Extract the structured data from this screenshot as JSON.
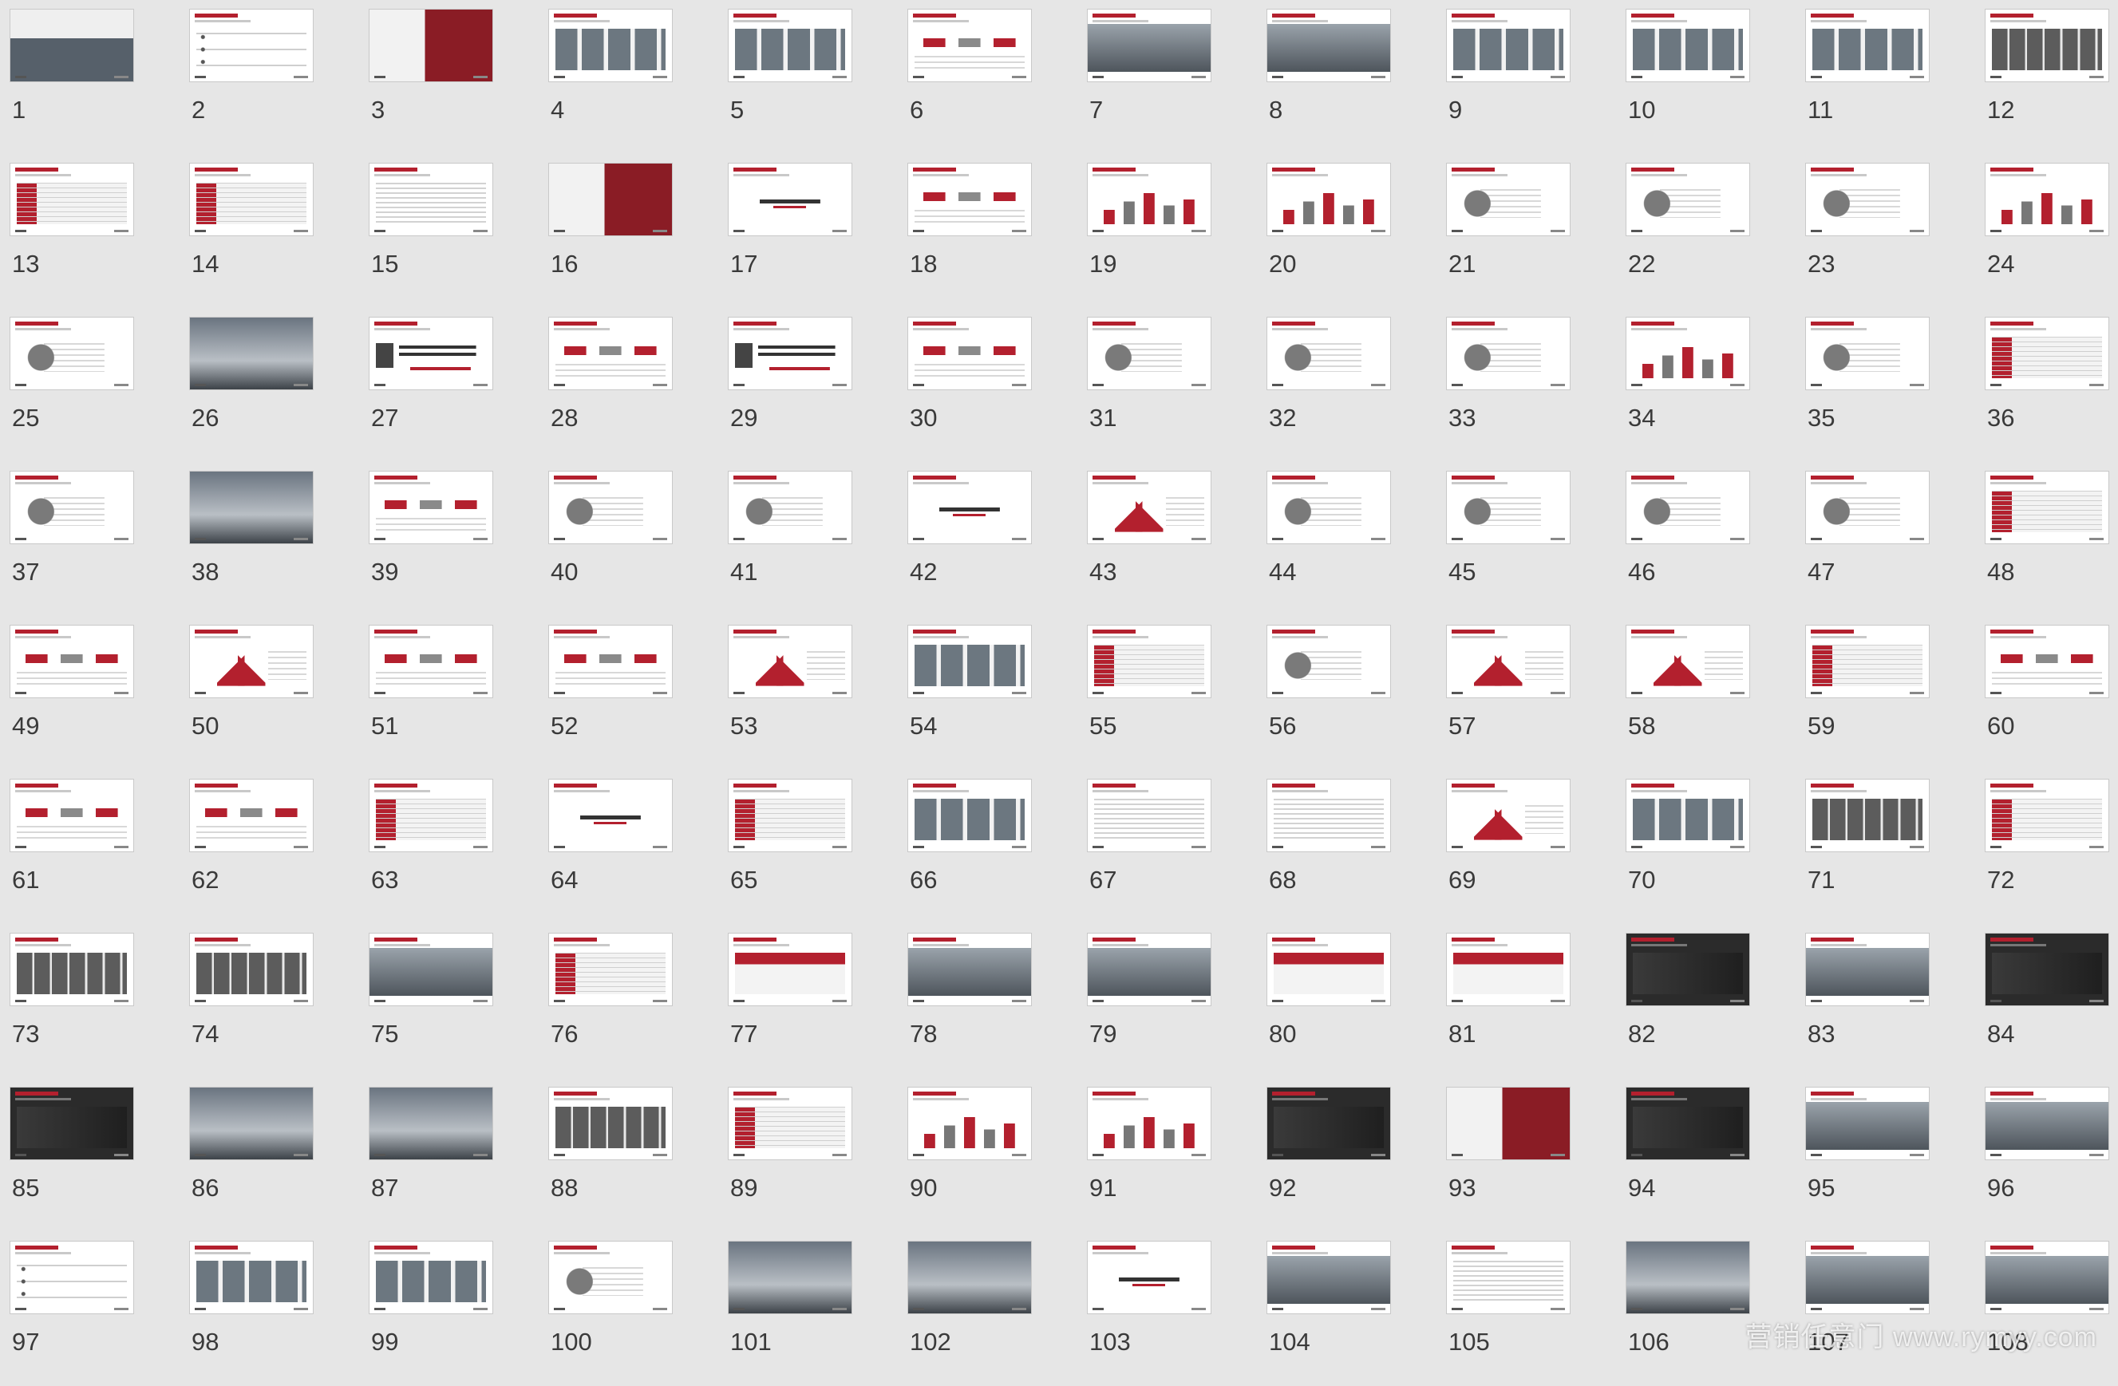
{
  "slides": [
    {
      "n": "1",
      "v": "cover"
    },
    {
      "n": "2",
      "v": "list"
    },
    {
      "n": "3",
      "v": "red"
    },
    {
      "n": "4",
      "v": "grid"
    },
    {
      "n": "5",
      "v": "grid"
    },
    {
      "n": "6",
      "v": "flow"
    },
    {
      "n": "7",
      "v": "photo"
    },
    {
      "n": "8",
      "v": "photo"
    },
    {
      "n": "9",
      "v": "grid"
    },
    {
      "n": "10",
      "v": "grid"
    },
    {
      "n": "11",
      "v": "grid"
    },
    {
      "n": "12",
      "v": "people"
    },
    {
      "n": "13",
      "v": "table"
    },
    {
      "n": "14",
      "v": "table"
    },
    {
      "n": "15",
      "v": "text"
    },
    {
      "n": "16",
      "v": "red"
    },
    {
      "n": "17",
      "v": "white"
    },
    {
      "n": "18",
      "v": "flow"
    },
    {
      "n": "19",
      "v": "chart"
    },
    {
      "n": "20",
      "v": "chart"
    },
    {
      "n": "21",
      "v": "circle"
    },
    {
      "n": "22",
      "v": "circle"
    },
    {
      "n": "23",
      "v": "circle"
    },
    {
      "n": "24",
      "v": "chart"
    },
    {
      "n": "25",
      "v": "circle"
    },
    {
      "n": "26",
      "v": "hero"
    },
    {
      "n": "27",
      "v": "year"
    },
    {
      "n": "28",
      "v": "flow"
    },
    {
      "n": "29",
      "v": "year"
    },
    {
      "n": "30",
      "v": "flow"
    },
    {
      "n": "31",
      "v": "circle"
    },
    {
      "n": "32",
      "v": "circle"
    },
    {
      "n": "33",
      "v": "circle"
    },
    {
      "n": "34",
      "v": "chart"
    },
    {
      "n": "35",
      "v": "circle"
    },
    {
      "n": "36",
      "v": "table"
    },
    {
      "n": "37",
      "v": "circle"
    },
    {
      "n": "38",
      "v": "hero"
    },
    {
      "n": "39",
      "v": "flow"
    },
    {
      "n": "40",
      "v": "circle"
    },
    {
      "n": "41",
      "v": "circle"
    },
    {
      "n": "42",
      "v": "white"
    },
    {
      "n": "43",
      "v": "tri"
    },
    {
      "n": "44",
      "v": "circle"
    },
    {
      "n": "45",
      "v": "circle"
    },
    {
      "n": "46",
      "v": "circle"
    },
    {
      "n": "47",
      "v": "circle"
    },
    {
      "n": "48",
      "v": "table"
    },
    {
      "n": "49",
      "v": "flow"
    },
    {
      "n": "50",
      "v": "tri"
    },
    {
      "n": "51",
      "v": "flow"
    },
    {
      "n": "52",
      "v": "flow"
    },
    {
      "n": "53",
      "v": "tri"
    },
    {
      "n": "54",
      "v": "grid"
    },
    {
      "n": "55",
      "v": "table"
    },
    {
      "n": "56",
      "v": "circle"
    },
    {
      "n": "57",
      "v": "tri"
    },
    {
      "n": "58",
      "v": "tri"
    },
    {
      "n": "59",
      "v": "table"
    },
    {
      "n": "60",
      "v": "flow"
    },
    {
      "n": "61",
      "v": "flow"
    },
    {
      "n": "62",
      "v": "flow"
    },
    {
      "n": "63",
      "v": "table"
    },
    {
      "n": "64",
      "v": "white"
    },
    {
      "n": "65",
      "v": "table"
    },
    {
      "n": "66",
      "v": "grid"
    },
    {
      "n": "67",
      "v": "text"
    },
    {
      "n": "68",
      "v": "text"
    },
    {
      "n": "69",
      "v": "tri"
    },
    {
      "n": "70",
      "v": "grid"
    },
    {
      "n": "71",
      "v": "people"
    },
    {
      "n": "72",
      "v": "table"
    },
    {
      "n": "73",
      "v": "people"
    },
    {
      "n": "74",
      "v": "people"
    },
    {
      "n": "75",
      "v": "photo"
    },
    {
      "n": "76",
      "v": "table"
    },
    {
      "n": "77",
      "v": "banner"
    },
    {
      "n": "78",
      "v": "photo"
    },
    {
      "n": "79",
      "v": "photo"
    },
    {
      "n": "80",
      "v": "banner"
    },
    {
      "n": "81",
      "v": "banner"
    },
    {
      "n": "82",
      "v": "dark"
    },
    {
      "n": "83",
      "v": "photo"
    },
    {
      "n": "84",
      "v": "dark"
    },
    {
      "n": "85",
      "v": "dark"
    },
    {
      "n": "86",
      "v": "hero"
    },
    {
      "n": "87",
      "v": "hero"
    },
    {
      "n": "88",
      "v": "people"
    },
    {
      "n": "89",
      "v": "table"
    },
    {
      "n": "90",
      "v": "chart"
    },
    {
      "n": "91",
      "v": "chart"
    },
    {
      "n": "92",
      "v": "dark"
    },
    {
      "n": "93",
      "v": "red"
    },
    {
      "n": "94",
      "v": "dark"
    },
    {
      "n": "95",
      "v": "photo"
    },
    {
      "n": "96",
      "v": "photo"
    },
    {
      "n": "97",
      "v": "list"
    },
    {
      "n": "98",
      "v": "grid"
    },
    {
      "n": "99",
      "v": "grid"
    },
    {
      "n": "100",
      "v": "circle"
    },
    {
      "n": "101",
      "v": "hero"
    },
    {
      "n": "102",
      "v": "hero"
    },
    {
      "n": "103",
      "v": "white"
    },
    {
      "n": "104",
      "v": "photo"
    },
    {
      "n": "105",
      "v": "text"
    },
    {
      "n": "106",
      "v": "hero"
    },
    {
      "n": "107",
      "v": "photo"
    },
    {
      "n": "108",
      "v": "photo"
    }
  ],
  "watermark": "营销任意门 www.rymyy.com"
}
